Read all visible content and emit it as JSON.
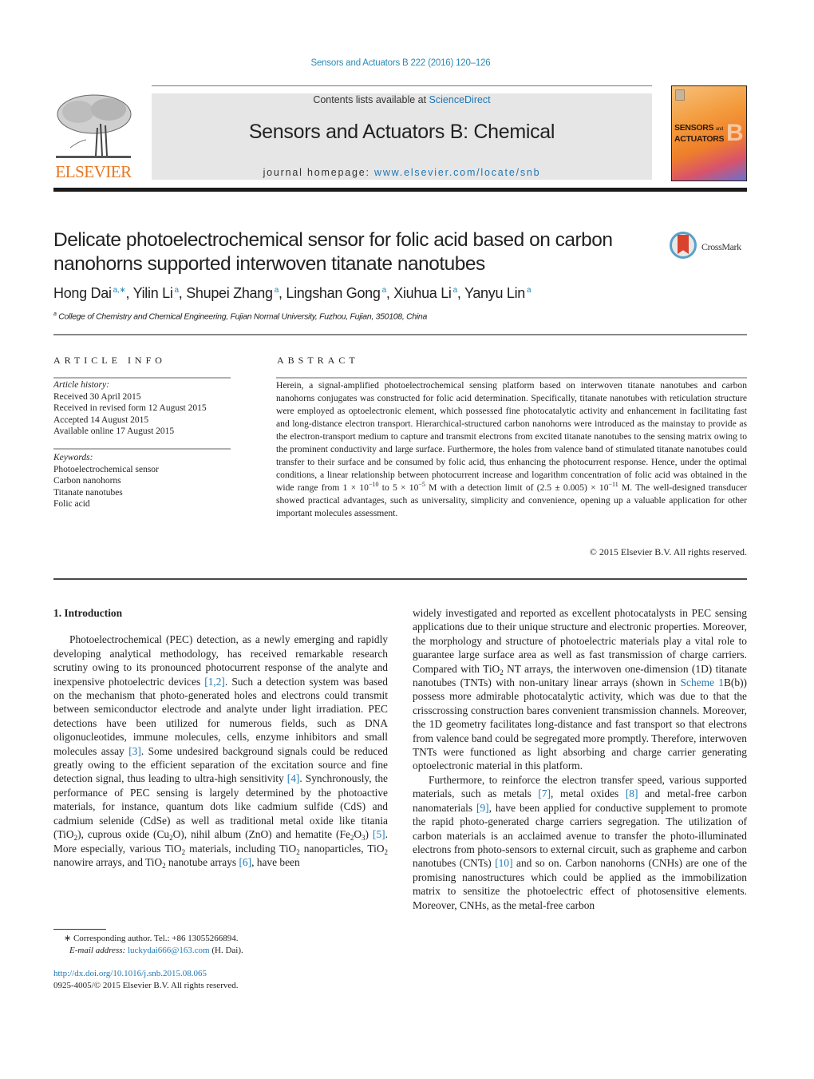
{
  "header": {
    "citation": "Sensors and Actuators B 222 (2016) 120–126",
    "publisher_logo_text": "ELSEVIER",
    "contents_prefix": "Contents lists available at ",
    "contents_link": "ScienceDirect",
    "journal_title": "Sensors and Actuators B: Chemical",
    "homepage_prefix": "journal homepage: ",
    "homepage_link": "www.elsevier.com/locate/snb",
    "cover": {
      "line1": "SENSORS",
      "and": "and",
      "line2": "ACTUATORS",
      "letter": "B"
    },
    "colors": {
      "elsevier_orange": "#e87722",
      "link_blue": "#2a8ab5",
      "header_box": "#e6e6e6"
    }
  },
  "article": {
    "title": "Delicate photoelectrochemical sensor for folic acid based on carbon nanohorns supported interwoven titanate nanotubes",
    "crossmark_label": "CrossMark",
    "authors": [
      {
        "name": "Hong Dai",
        "sup": "a,∗"
      },
      {
        "name": "Yilin Li",
        "sup": "a"
      },
      {
        "name": "Shupei Zhang",
        "sup": "a"
      },
      {
        "name": "Lingshan Gong",
        "sup": "a"
      },
      {
        "name": "Xiuhua Li",
        "sup": "a"
      },
      {
        "name": "Yanyu Lin",
        "sup": "a"
      }
    ],
    "affiliation_mark": "a",
    "affiliation": "College of Chemistry and Chemical Engineering, Fujian Normal University, Fuzhou, Fujian, 350108, China"
  },
  "article_info": {
    "heading": "ARTICLE INFO",
    "history_label": "Article history:",
    "history": [
      "Received 30 April 2015",
      "Received in revised form 12 August 2015",
      "Accepted 14 August 2015",
      "Available online 17 August 2015"
    ],
    "keywords_label": "Keywords:",
    "keywords": [
      "Photoelectrochemical sensor",
      "Carbon nanohorns",
      "Titanate nanotubes",
      "Folic acid"
    ]
  },
  "abstract": {
    "heading": "ABSTRACT",
    "text_part1": "Herein, a signal-amplified photoelectrochemical sensing platform based on interwoven titanate nanotubes and carbon nanohorns conjugates was constructed for folic acid determination. Specifically, titanate nanotubes with reticulation structure were employed as optoelectronic element, which possessed fine photocatalytic activity and enhancement in facilitating fast and long-distance electron transport. Hierarchical-structured carbon nanohorns were introduced as the mainstay to provide as the electron-transport medium to capture and transmit electrons from excited titanate nanotubes to the sensing matrix owing to the prominent conductivity and large surface. Furthermore, the holes from valence band of stimulated titanate nanotubes could transfer to their surface and be consumed by folic acid, thus enhancing the photocurrent response. Hence, under the optimal conditions, a linear relationship between photocurrent increase and logarithm concentration of folic acid was obtained in the wide range from ",
    "range_low": "1 × 10",
    "range_low_exp": "−10",
    "range_to": " to 5 × 10",
    "range_high_exp": "−5",
    "detection_prefix": " M with a detection limit of (2.5 ± 0.005) × 10",
    "detection_exp": "−11",
    "text_part2": " M. The well-designed transducer showed practical advantages, such as universality, simplicity and convenience, opening up a valuable application for other important molecules assessment.",
    "copyright": "© 2015 Elsevier B.V. All rights reserved."
  },
  "body": {
    "section_heading": "1.  Introduction",
    "left": {
      "p1_a": "Photoelectrochemical (PEC) detection, as a newly emerging and rapidly developing analytical methodology, has received remarkable research scrutiny owing to its pronounced photocurrent response of the analyte and inexpensive photoelectric devices ",
      "ref_1_2": "[1,2]",
      "p1_b": ". Such a detection system was based on the mechanism that photo-generated holes and electrons could transmit between semiconductor electrode and analyte under light irradiation. PEC detections have been utilized for numerous fields, such as DNA oligonucleotides, immune molecules, cells, enzyme inhibitors and small molecules assay ",
      "ref_3": "[3]",
      "p1_c": ". Some undesired background signals could be reduced greatly owing to the efficient separation of the excitation source and fine detection signal, thus leading to ultra-high sensitivity ",
      "ref_4": "[4]",
      "p1_d": ". Synchronously, the performance of PEC sensing is largely determined by the photoactive materials, for instance, quantum dots like cadmium sulfide (CdS) and cadmium selenide (CdSe) as well as traditional metal oxide like titania (TiO",
      "p1_e": "), cuprous oxide (Cu",
      "p1_f": "O), nihil album (ZnO) and hematite (Fe",
      "p1_g": "O",
      "p1_h": ") ",
      "ref_5": "[5]",
      "p1_i": ". More especially, various TiO",
      "p1_j": " materials, including TiO",
      "p1_k": " nanoparticles, TiO",
      "p1_l": " nanowire arrays, and TiO",
      "p1_m": " nanotube arrays ",
      "ref_6": "[6]",
      "p1_n": ", have been",
      "sub_2": "2",
      "sub_3": "3"
    },
    "right": {
      "p1_a": "widely investigated and reported as excellent photocatalysts in PEC sensing applications due to their unique structure and electronic properties. Moreover, the morphology and structure of photoelectric materials play a vital role to guarantee large surface area as well as fast transmission of charge carriers. Compared with TiO",
      "p1_b": " NT arrays, the interwoven one-dimension (1D) titanate nanotubes (TNTs) with non-unitary linear arrays (shown in ",
      "scheme_link": "Scheme 1",
      "p1_c": "B(b)) possess more admirable photocatalytic activity, which was due to that the crisscrossing construction bares convenient transmission channels. Moreover, the 1D geometry facilitates long-distance and fast transport so that electrons from valence band could be segregated more promptly. Therefore, interwoven TNTs were functioned as light absorbing and charge carrier generating optoelectronic material in this platform.",
      "p2_a": "Furthermore, to reinforce the electron transfer speed, various supported materials, such as metals ",
      "ref_7": "[7]",
      "p2_b": ", metal oxides ",
      "ref_8": "[8]",
      "p2_c": " and metal-free carbon nanomaterials ",
      "ref_9": "[9]",
      "p2_d": ", have been applied for conductive supplement to promote the rapid photo-generated charge carriers segregation. The utilization of carbon materials is an acclaimed avenue to transfer the photo-illuminated electrons from photo-sensors to external circuit, such as grapheme and carbon nanotubes (CNTs) ",
      "ref_10": "[10]",
      "p2_e": " and so on. Carbon nanohorns (CNHs) are one of the promising nanostructures which could be applied as the immobilization matrix to sensitize the photoelectric effect of photosensitive elements. Moreover, CNHs, as the metal-free carbon",
      "sub_2": "2"
    }
  },
  "footer": {
    "corresponding_mark": "∗",
    "corresponding": " Corresponding author. Tel.: +86 13055266894.",
    "email_label": "E-mail address: ",
    "email": "luckydai666@163.com",
    "email_suffix": " (H. Dai).",
    "doi": "http://dx.doi.org/10.1016/j.snb.2015.08.065",
    "issn": "0925-4005/© 2015 Elsevier B.V. All rights reserved."
  }
}
